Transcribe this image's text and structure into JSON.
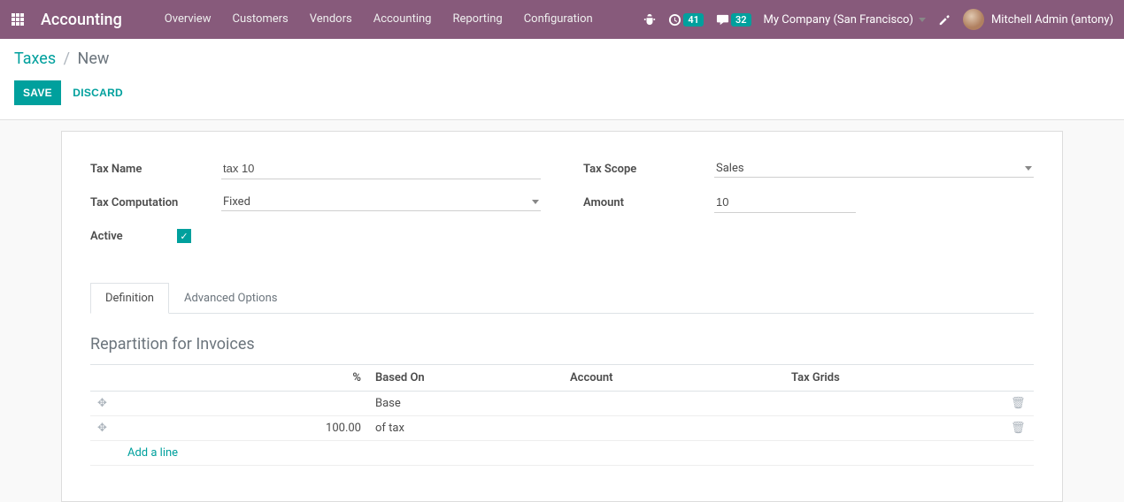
{
  "navbar": {
    "brand": "Accounting",
    "menu": [
      "Overview",
      "Customers",
      "Vendors",
      "Accounting",
      "Reporting",
      "Configuration"
    ],
    "activity_count": "41",
    "message_count": "32",
    "company": "My Company (San Francisco)",
    "user": "Mitchell Admin (antony)"
  },
  "breadcrumb": {
    "parent": "Taxes",
    "current": "New"
  },
  "buttons": {
    "save": "SAVE",
    "discard": "DISCARD"
  },
  "form": {
    "tax_name": {
      "label": "Tax Name",
      "value": "tax 10"
    },
    "tax_computation": {
      "label": "Tax Computation",
      "value": "Fixed"
    },
    "active": {
      "label": "Active",
      "checked": true
    },
    "tax_scope": {
      "label": "Tax Scope",
      "value": "Sales"
    },
    "amount": {
      "label": "Amount",
      "value": "10"
    }
  },
  "tabs": {
    "definition": "Definition",
    "advanced": "Advanced Options"
  },
  "repartition": {
    "title": "Repartition for Invoices",
    "columns": {
      "percent": "%",
      "based_on": "Based On",
      "account": "Account",
      "tax_grids": "Tax Grids"
    },
    "rows": [
      {
        "percent": "",
        "based_on": "Base",
        "account": "",
        "tax_grids": ""
      },
      {
        "percent": "100.00",
        "based_on": "of tax",
        "account": "",
        "tax_grids": ""
      }
    ],
    "add_line": "Add a line"
  }
}
